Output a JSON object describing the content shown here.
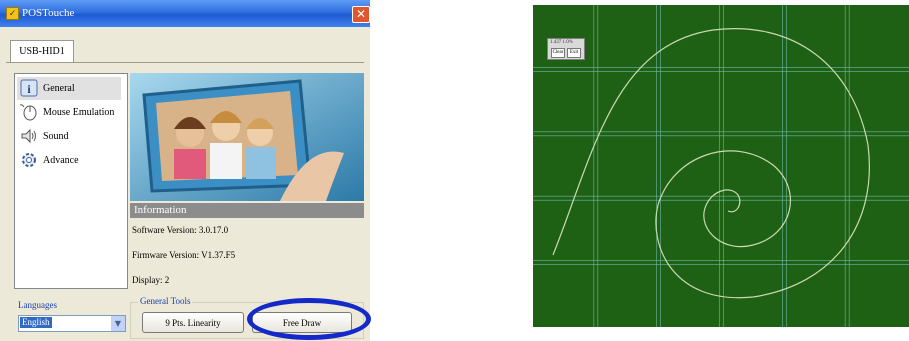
{
  "window": {
    "title": "POSTouche",
    "close_glyph": "✕",
    "app_icon": "check-icon"
  },
  "device_tab": {
    "label": "USB-HID1"
  },
  "nav": {
    "items": [
      {
        "label": "General",
        "icon": "info-icon"
      },
      {
        "label": "Mouse Emulation",
        "icon": "mouse-icon"
      },
      {
        "label": "Sound",
        "icon": "speaker-icon"
      },
      {
        "label": "Advance",
        "icon": "gear-icon"
      }
    ]
  },
  "information": {
    "header": "Information",
    "software_version": "Software Version: 3.0.17.0",
    "firmware_version": "Firmware Version: V1.37.F5",
    "display": "Display: 2"
  },
  "language": {
    "label": "Languages",
    "selected": "English"
  },
  "tools": {
    "group_label": "General Tools",
    "linearity_button": "9 Pts. Linearity",
    "free_draw_button": "Free Draw"
  },
  "draw_canvas": {
    "background_color": "#1f6114",
    "grid_color": "#6fb7a4",
    "stroke_color": "#c9d9b0",
    "mini_window": {
      "text": "1.437 1.0%",
      "buttons": [
        "Clear",
        "Exit"
      ]
    }
  },
  "colors": {
    "titlebar": "#2f6fe0",
    "highlight_ring": "#1429c9"
  }
}
